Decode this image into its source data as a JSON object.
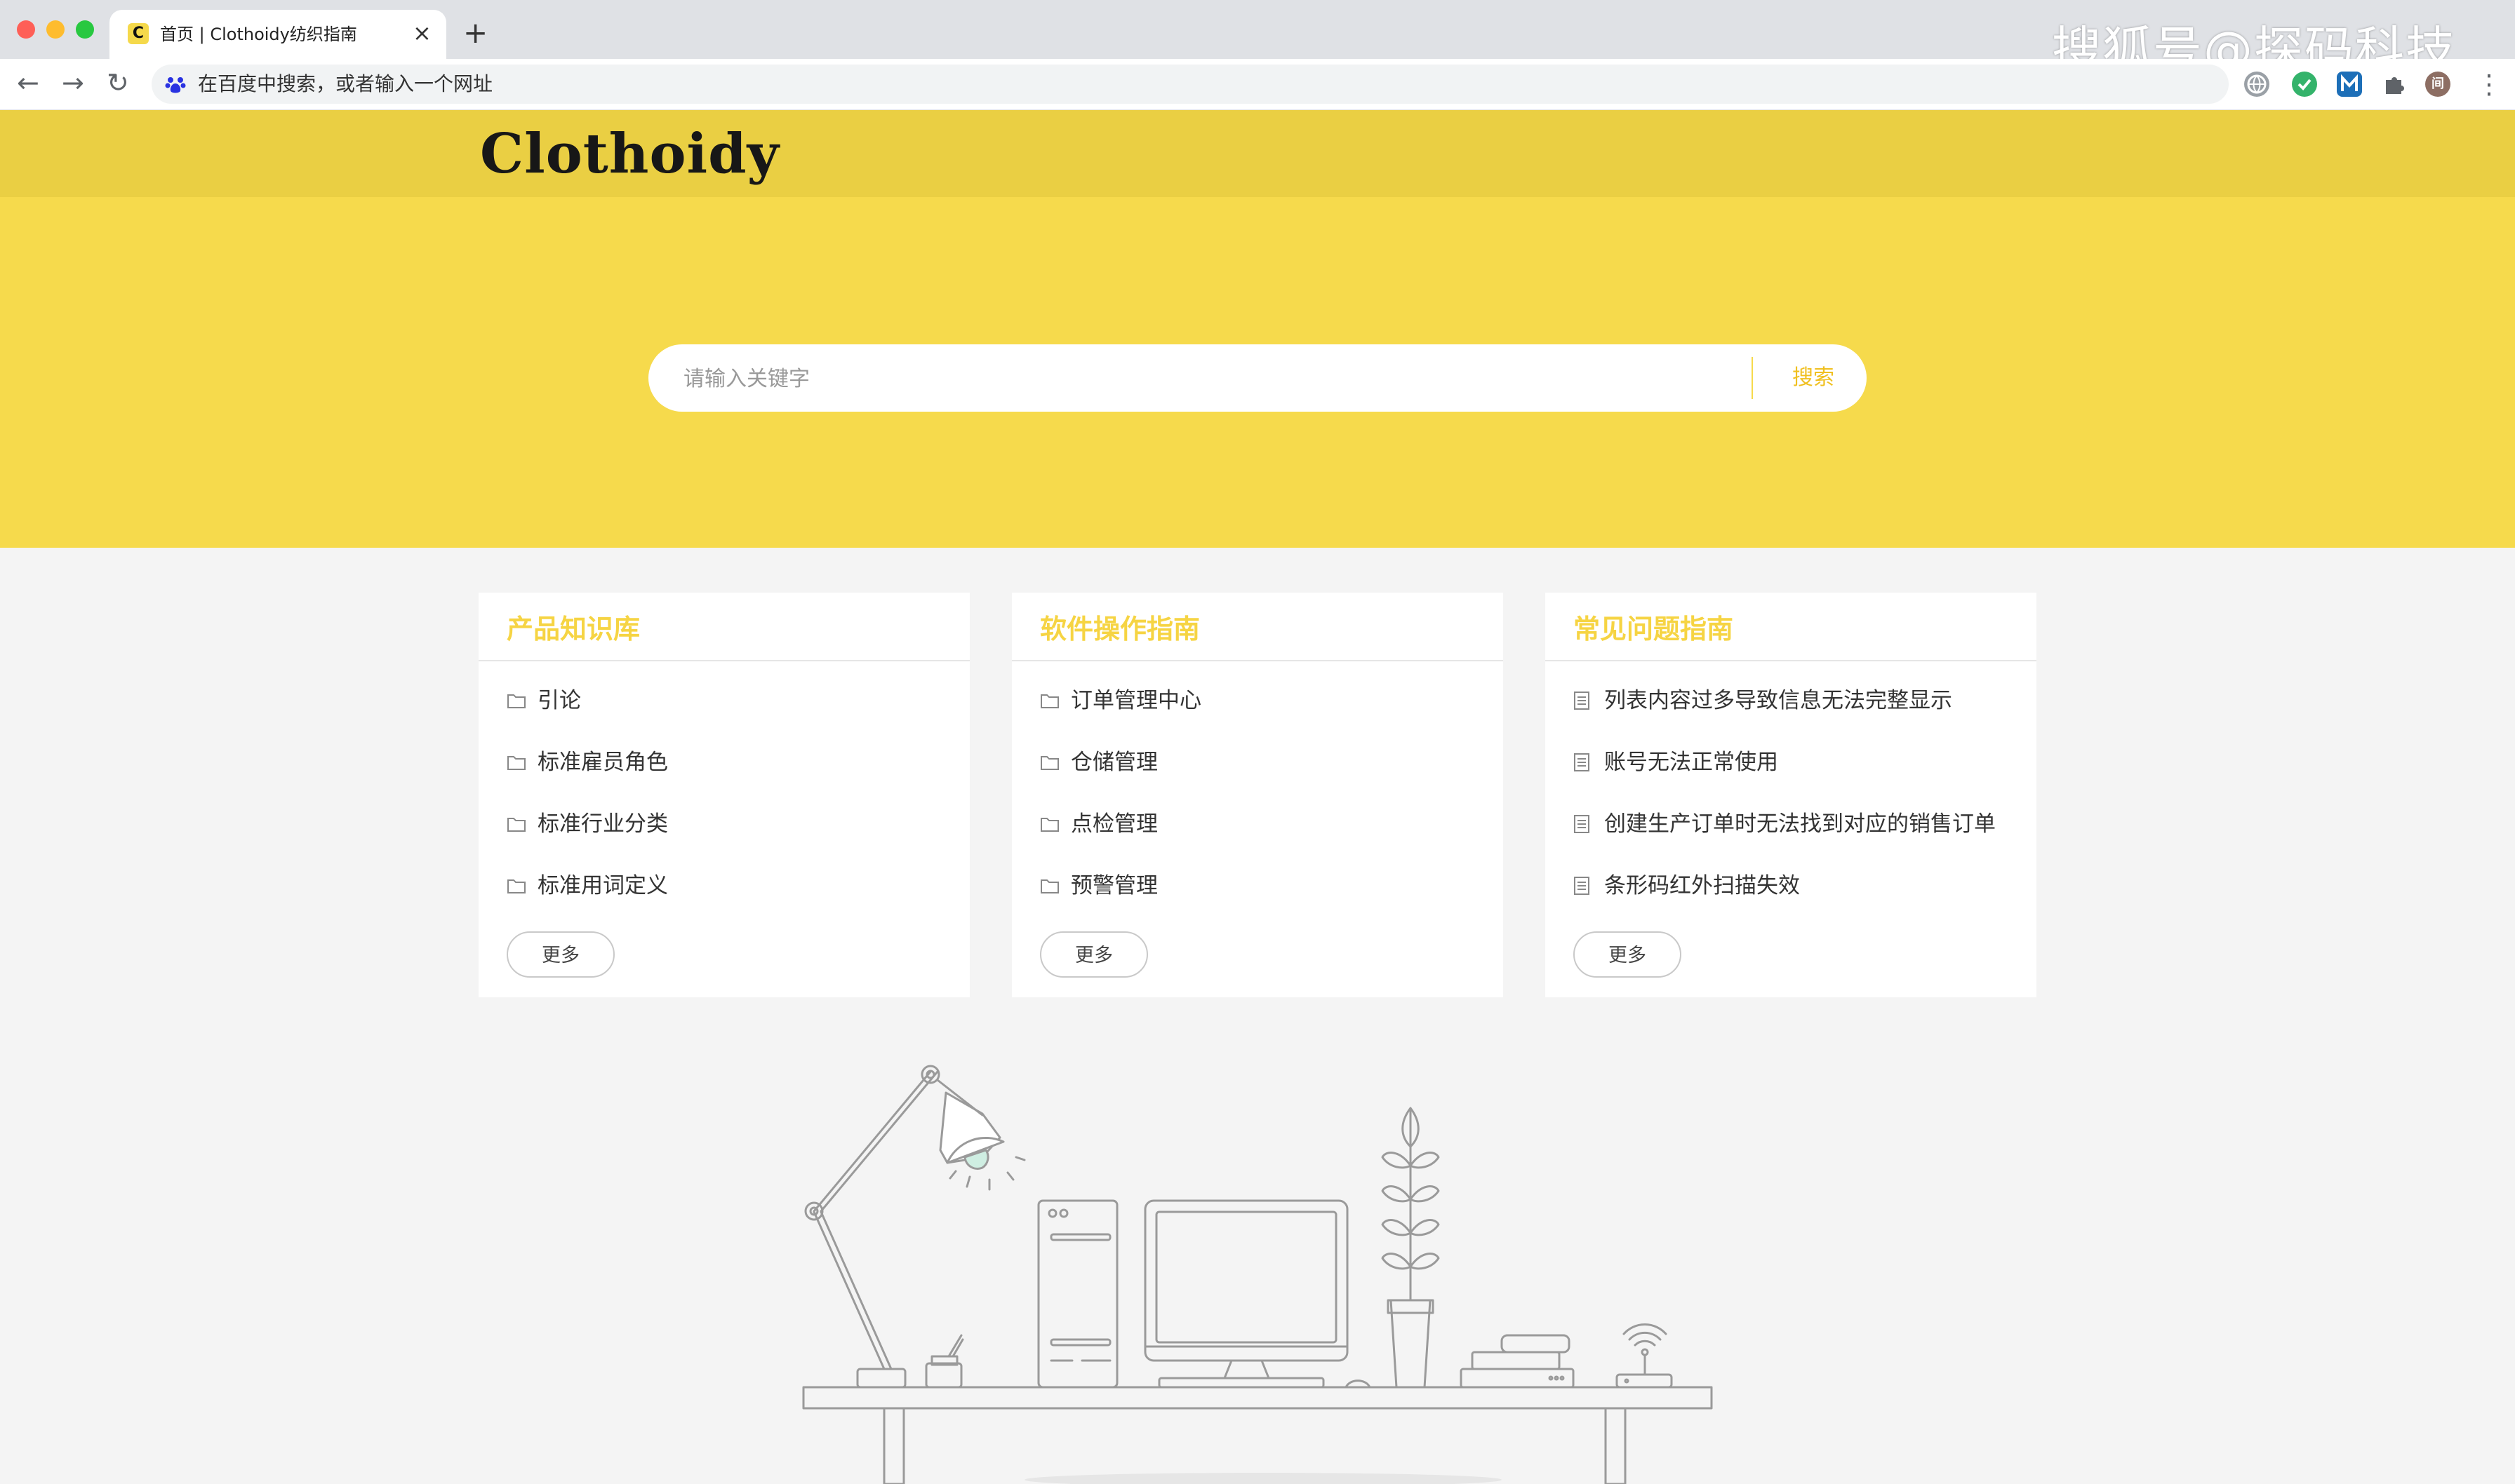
{
  "browser": {
    "tab_title": "首页 | Clothoidy纺织指南",
    "tab_favicon_letter": "C",
    "tab_close": "×",
    "new_tab": "+",
    "nav_back": "←",
    "nav_forward": "→",
    "nav_reload": "↻",
    "address_placeholder": "在百度中搜索，或者输入一个网址",
    "extensions": [
      "globe-icon",
      "shield-check-icon",
      "m-extension-icon",
      "puzzle-icon"
    ],
    "avatar_label": "间",
    "menu": "⋮",
    "watermark": "搜狐号@探码科技"
  },
  "site": {
    "logo": "Clothoidy",
    "search": {
      "placeholder": "请输入关键字",
      "button": "搜索"
    }
  },
  "colors": {
    "header": "#eacf43",
    "hero": "#f6da4c",
    "accent_title": "#f6d443",
    "page_bg": "#f4f4f4"
  },
  "cards": [
    {
      "title": "产品知识库",
      "icon": "folder-icon",
      "items": [
        "引论",
        "标准雇员角色",
        "标准行业分类",
        "标准用词定义"
      ],
      "more": "更多"
    },
    {
      "title": "软件操作指南",
      "icon": "folder-icon",
      "items": [
        "订单管理中心",
        "仓储管理",
        "点检管理",
        "预警管理"
      ],
      "more": "更多"
    },
    {
      "title": "常见问题指南",
      "icon": "document-icon",
      "items": [
        "列表内容过多导致信息无法完整显示",
        "账号无法正常使用",
        "创建生产订单时无法找到对应的销售订单",
        "条形码红外扫描失效"
      ],
      "more": "更多"
    }
  ]
}
